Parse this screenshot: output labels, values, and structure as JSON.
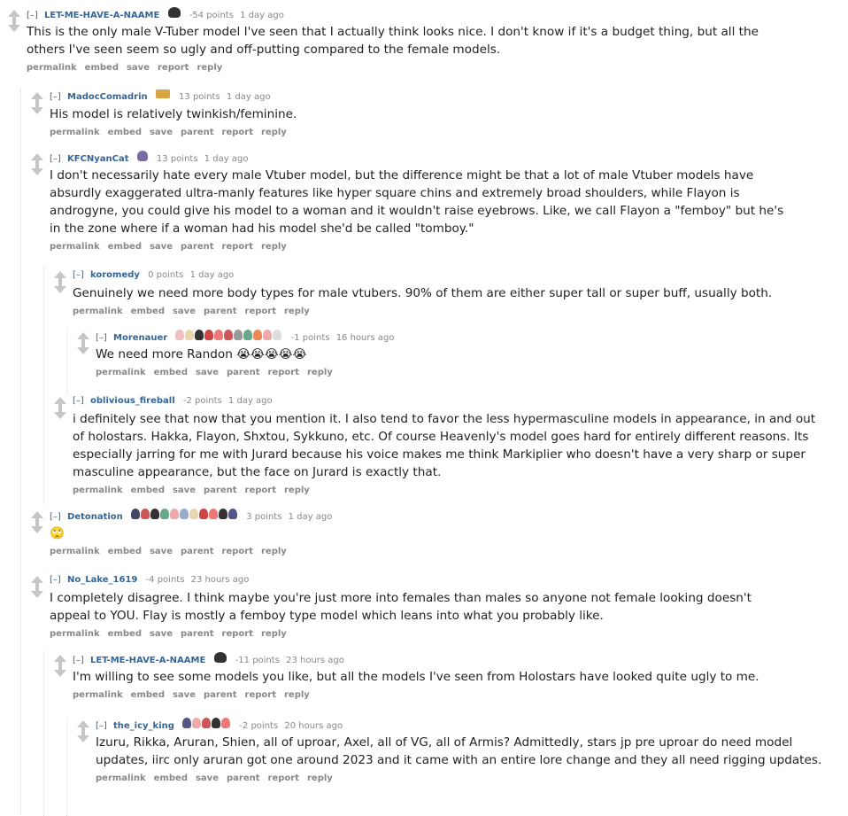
{
  "expand_label": "[–]",
  "buttons_top": [
    "permalink",
    "embed",
    "save",
    "report",
    "reply"
  ],
  "buttons_child": [
    "permalink",
    "embed",
    "save",
    "parent",
    "report",
    "reply"
  ],
  "comments": [
    {
      "author": "LET-ME-HAVE-A-NAAME",
      "score": "-54 points",
      "time": "1 day ago",
      "body": "This is the only male V-Tuber model I've seen that I actually think looks nice. I don't know if it's a budget thing, but all the others I've seen seem so ugly and off-putting compared to the female models."
    },
    {
      "author": "MadocComadrin",
      "score": "13 points",
      "time": "1 day ago",
      "body": "His model is relatively twinkish/feminine."
    },
    {
      "author": "KFCNyanCat",
      "score": "13 points",
      "time": "1 day ago",
      "body": "I don't necessarily hate every male Vtuber model, but the difference might be that a lot of male Vtuber models have absurdly exaggerated ultra-manly features like hyper square chins and extremely broad shoulders, while Flayon is androgyne, you could give his model to a woman and it wouldn't raise eyebrows. Like, we call Flayon a \"femboy\" but he's in the zone where if a woman had his model she'd be called \"tomboy.\""
    },
    {
      "author": "koromedy",
      "score": "0 points",
      "time": "1 day ago",
      "body": "Genuinely we need more body types for male vtubers. 90% of them are either super tall or super buff, usually both."
    },
    {
      "author": "Morenauer",
      "score": "-1 points",
      "time": "16 hours ago",
      "body": "We need more Randon 😭😭😭😭😭"
    },
    {
      "author": "oblivious_fireball",
      "score": "-2 points",
      "time": "1 day ago",
      "body": "i definitely see that now that you mention it. I also tend to favor the less hypermasculine models in appearance, in and out of holostars. Hakka, Flayon, Shxtou, Sykkuno, etc. Of course Heavenly's model goes hard for entirely different reasons. Its especially jarring for me with Jurard because his voice makes me think Markiplier who doesn't have a very sharp or super masculine appearance, but the face on Jurard is exactly that."
    },
    {
      "author": "Detonation",
      "score": "3 points",
      "time": "1 day ago",
      "body": "🙄"
    },
    {
      "author": "No_Lake_1619",
      "score": "-4 points",
      "time": "23 hours ago",
      "body": "I completely disagree. I think maybe you're just more into females than males so anyone not female looking doesn't appeal to YOU. Flay is mostly a femboy type model which leans into what you probably like."
    },
    {
      "author": "LET-ME-HAVE-A-NAAME",
      "score": "-11 points",
      "time": "23 hours ago",
      "body": "I'm willing to see some models you like, but all the models I've seen from Holostars have looked quite ugly to me."
    },
    {
      "author": "the_icy_king",
      "score": "-2 points",
      "time": "20 hours ago",
      "body": "Izuru, Rikka, Aruran, Shien, all of uproar, Axel, all of VG, all of Armis? Admittedly, stars jp pre uproar do need model updates, iirc only aruran got one around 2023 and it came with an entire lore change and they all need rigging updates."
    }
  ]
}
